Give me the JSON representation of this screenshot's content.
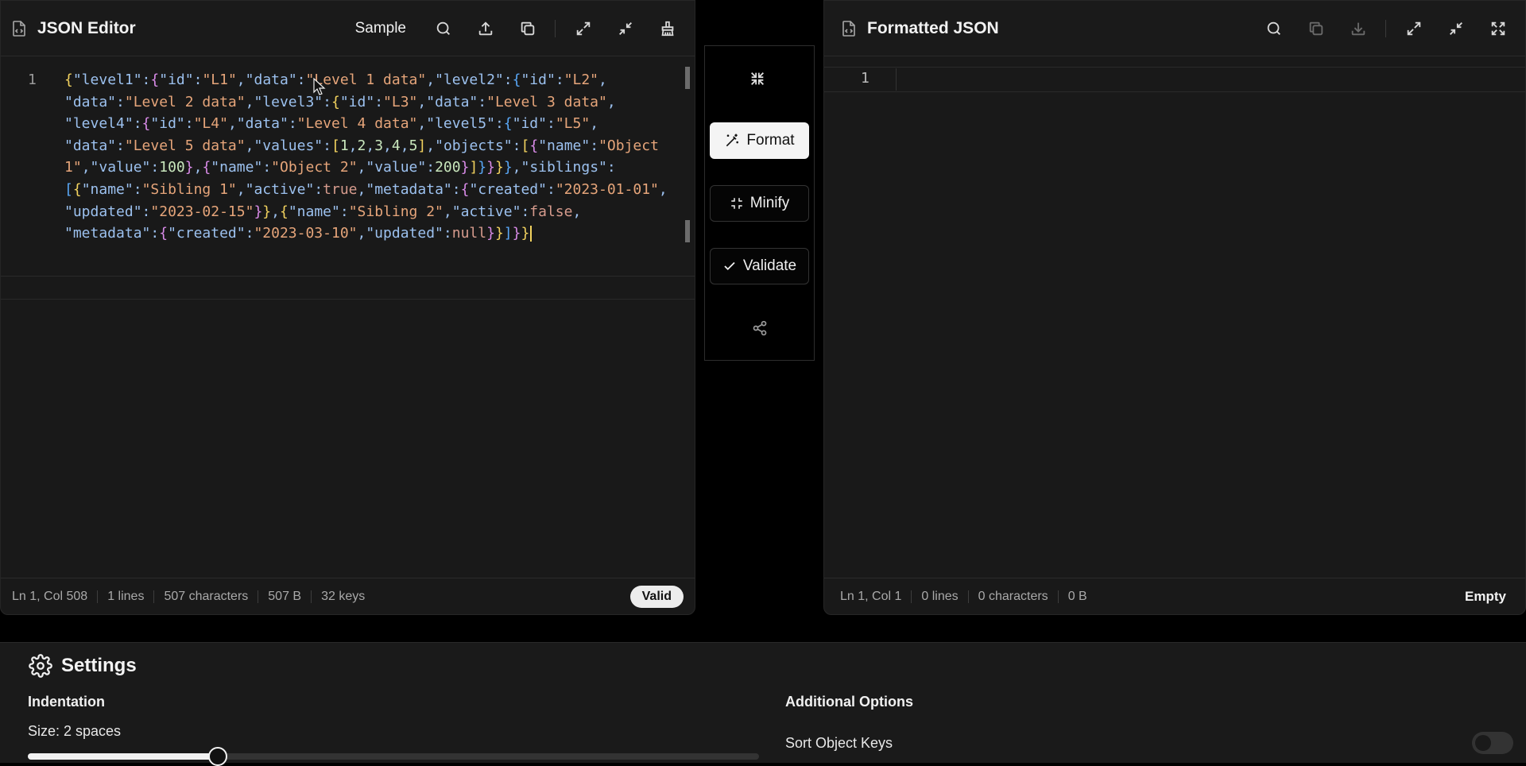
{
  "editor": {
    "title": "JSON Editor",
    "sample_label": "Sample",
    "line_number": "1",
    "code_lines": [
      [
        [
          "p1",
          "{"
        ],
        [
          "k",
          "\"level1\""
        ],
        [
          "k",
          ":"
        ],
        [
          "p2",
          "{"
        ],
        [
          "k",
          "\"id\""
        ],
        [
          "k",
          ":"
        ],
        [
          "s",
          "\"L1\""
        ],
        [
          "k",
          ","
        ],
        [
          "k",
          "\"data\""
        ],
        [
          "k",
          ":"
        ],
        [
          "s",
          "\"Level 1 data\""
        ],
        [
          "k",
          ","
        ],
        [
          "k",
          "\"level2\""
        ],
        [
          "k",
          ":"
        ],
        [
          "p3",
          "{"
        ],
        [
          "k",
          "\"id\""
        ],
        [
          "k",
          ":"
        ],
        [
          "s",
          "\"L2\""
        ],
        [
          "k",
          ","
        ]
      ],
      [
        [
          "k",
          "\"data\""
        ],
        [
          "k",
          ":"
        ],
        [
          "s",
          "\"Level 2 data\""
        ],
        [
          "k",
          ","
        ],
        [
          "k",
          "\"level3\""
        ],
        [
          "k",
          ":"
        ],
        [
          "p1",
          "{"
        ],
        [
          "k",
          "\"id\""
        ],
        [
          "k",
          ":"
        ],
        [
          "s",
          "\"L3\""
        ],
        [
          "k",
          ","
        ],
        [
          "k",
          "\"data\""
        ],
        [
          "k",
          ":"
        ],
        [
          "s",
          "\"Level 3 data\""
        ],
        [
          "k",
          ","
        ]
      ],
      [
        [
          "k",
          "\"level4\""
        ],
        [
          "k",
          ":"
        ],
        [
          "p2",
          "{"
        ],
        [
          "k",
          "\"id\""
        ],
        [
          "k",
          ":"
        ],
        [
          "s",
          "\"L4\""
        ],
        [
          "k",
          ","
        ],
        [
          "k",
          "\"data\""
        ],
        [
          "k",
          ":"
        ],
        [
          "s",
          "\"Level 4 data\""
        ],
        [
          "k",
          ","
        ],
        [
          "k",
          "\"level5\""
        ],
        [
          "k",
          ":"
        ],
        [
          "p3",
          "{"
        ],
        [
          "k",
          "\"id\""
        ],
        [
          "k",
          ":"
        ],
        [
          "s",
          "\"L5\""
        ],
        [
          "k",
          ","
        ]
      ],
      [
        [
          "k",
          "\"data\""
        ],
        [
          "k",
          ":"
        ],
        [
          "s",
          "\"Level 5 data\""
        ],
        [
          "k",
          ","
        ],
        [
          "k",
          "\"values\""
        ],
        [
          "k",
          ":"
        ],
        [
          "p1",
          "["
        ],
        [
          "n",
          "1"
        ],
        [
          "k",
          ","
        ],
        [
          "n",
          "2"
        ],
        [
          "k",
          ","
        ],
        [
          "n",
          "3"
        ],
        [
          "k",
          ","
        ],
        [
          "n",
          "4"
        ],
        [
          "k",
          ","
        ],
        [
          "n",
          "5"
        ],
        [
          "p1",
          "]"
        ],
        [
          "k",
          ","
        ],
        [
          "k",
          "\"objects\""
        ],
        [
          "k",
          ":"
        ],
        [
          "p1",
          "["
        ],
        [
          "p2",
          "{"
        ],
        [
          "k",
          "\"name\""
        ],
        [
          "k",
          ":"
        ],
        [
          "s",
          "\"Object"
        ]
      ],
      [
        [
          "s",
          "1\""
        ],
        [
          "k",
          ","
        ],
        [
          "k",
          "\"value\""
        ],
        [
          "k",
          ":"
        ],
        [
          "n",
          "100"
        ],
        [
          "p2",
          "}"
        ],
        [
          "k",
          ","
        ],
        [
          "p2",
          "{"
        ],
        [
          "k",
          "\"name\""
        ],
        [
          "k",
          ":"
        ],
        [
          "s",
          "\"Object 2\""
        ],
        [
          "k",
          ","
        ],
        [
          "k",
          "\"value\""
        ],
        [
          "k",
          ":"
        ],
        [
          "n",
          "200"
        ],
        [
          "p2",
          "}"
        ],
        [
          "p1",
          "]"
        ],
        [
          "p3",
          "}"
        ],
        [
          "p2",
          "}"
        ],
        [
          "p1",
          "}"
        ],
        [
          "p3",
          "}"
        ],
        [
          "k",
          ","
        ],
        [
          "k",
          "\"siblings\""
        ],
        [
          "k",
          ":"
        ]
      ],
      [
        [
          "p3",
          "["
        ],
        [
          "p1",
          "{"
        ],
        [
          "k",
          "\"name\""
        ],
        [
          "k",
          ":"
        ],
        [
          "s",
          "\"Sibling 1\""
        ],
        [
          "k",
          ","
        ],
        [
          "k",
          "\"active\""
        ],
        [
          "k",
          ":"
        ],
        [
          "b",
          "true"
        ],
        [
          "k",
          ","
        ],
        [
          "k",
          "\"metadata\""
        ],
        [
          "k",
          ":"
        ],
        [
          "p2",
          "{"
        ],
        [
          "k",
          "\"created\""
        ],
        [
          "k",
          ":"
        ],
        [
          "s",
          "\"2023-01-01\""
        ],
        [
          "k",
          ","
        ]
      ],
      [
        [
          "k",
          "\"updated\""
        ],
        [
          "k",
          ":"
        ],
        [
          "s",
          "\"2023-02-15\""
        ],
        [
          "p2",
          "}"
        ],
        [
          "p1",
          "}"
        ],
        [
          "k",
          ","
        ],
        [
          "p1",
          "{"
        ],
        [
          "k",
          "\"name\""
        ],
        [
          "k",
          ":"
        ],
        [
          "s",
          "\"Sibling 2\""
        ],
        [
          "k",
          ","
        ],
        [
          "k",
          "\"active\""
        ],
        [
          "k",
          ":"
        ],
        [
          "b",
          "false"
        ],
        [
          "k",
          ","
        ]
      ],
      [
        [
          "k",
          "\"metadata\""
        ],
        [
          "k",
          ":"
        ],
        [
          "p2",
          "{"
        ],
        [
          "k",
          "\"created\""
        ],
        [
          "k",
          ":"
        ],
        [
          "s",
          "\"2023-03-10\""
        ],
        [
          "k",
          ","
        ],
        [
          "k",
          "\"updated\""
        ],
        [
          "k",
          ":"
        ],
        [
          "b",
          "null"
        ],
        [
          "p2",
          "}"
        ],
        [
          "p1",
          "}"
        ],
        [
          "p3",
          "]"
        ],
        [
          "p2",
          "}"
        ],
        [
          "p1",
          "}"
        ]
      ]
    ],
    "status": {
      "position": "Ln 1, Col 508",
      "lines": "1 lines",
      "characters": "507 characters",
      "size": "507 B",
      "keys": "32 keys",
      "badge": "Valid"
    }
  },
  "actions": {
    "format_label": "Format",
    "minify_label": "Minify",
    "validate_label": "Validate"
  },
  "output": {
    "title": "Formatted JSON",
    "line_number": "1",
    "status": {
      "position": "Ln 1, Col 1",
      "lines": "0 lines",
      "characters": "0 characters",
      "size": "0 B",
      "badge": "Empty"
    }
  },
  "settings": {
    "title": "Settings",
    "indentation_label": "Indentation",
    "size_label": "Size: 2 spaces",
    "indent_slider_fraction": 0.26,
    "additional_label": "Additional Options",
    "sort_keys_label": "Sort Object Keys"
  },
  "icons": {
    "file": "file-code-icon",
    "search": "search-icon",
    "upload": "upload-icon",
    "copy": "copy-icon",
    "expand": "expand-icon",
    "collapse": "collapse-icon",
    "clear": "broom-icon",
    "download": "download-icon",
    "fullscreen": "fullscreen-icon",
    "format": "magic-wand-icon",
    "minify": "minimize-icon",
    "validate": "check-icon",
    "share": "share-icon",
    "settings": "gear-icon"
  },
  "colors": {
    "background": "#000000",
    "panel": "#191919",
    "string": "#e6a57a",
    "key": "#9cc1ef",
    "number": "#c9e7bd",
    "bracket_1": "#f3d35f",
    "bracket_2": "#d98be8",
    "bracket_3": "#59a7f6"
  }
}
